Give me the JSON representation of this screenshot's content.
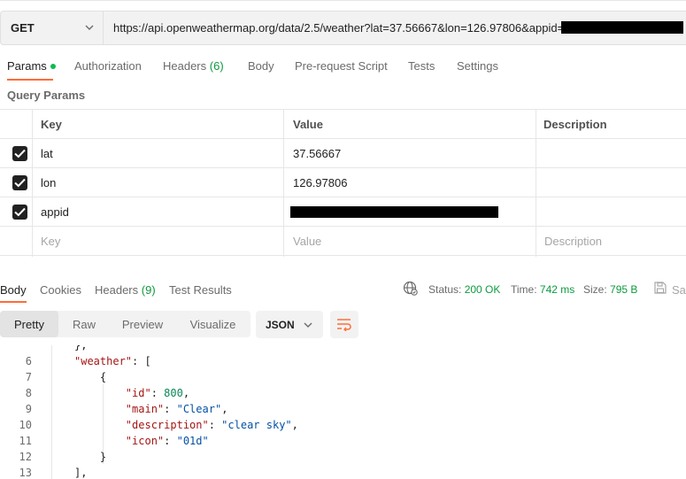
{
  "request": {
    "method": "GET",
    "url": "https://api.openweathermap.org/data/2.5/weather?lat=37.56667&lon=126.97806&appid="
  },
  "tabs": [
    {
      "label": "Params"
    },
    {
      "label": "Authorization"
    },
    {
      "label": "Headers",
      "count": "(6)"
    },
    {
      "label": "Body"
    },
    {
      "label": "Pre-request Script"
    },
    {
      "label": "Tests"
    },
    {
      "label": "Settings"
    }
  ],
  "query_params": {
    "title": "Query Params",
    "headers": {
      "key": "Key",
      "value": "Value",
      "description": "Description"
    },
    "rows": [
      {
        "key": "lat",
        "value": "37.56667"
      },
      {
        "key": "lon",
        "value": "126.97806"
      },
      {
        "key": "appid",
        "value": ""
      }
    ],
    "placeholder": {
      "key": "Key",
      "value": "Value",
      "description": "Description"
    }
  },
  "response": {
    "tabs": [
      {
        "label": "Body"
      },
      {
        "label": "Cookies"
      },
      {
        "label": "Headers",
        "count": "(9)"
      },
      {
        "label": "Test Results"
      }
    ],
    "status_label": "Status:",
    "status_value": "200 OK",
    "time_label": "Time:",
    "time_value": "742 ms",
    "size_label": "Size:",
    "size_value": "795 B",
    "save_label": "Sa"
  },
  "format": {
    "options": [
      "Pretty",
      "Raw",
      "Preview",
      "Visualize"
    ],
    "selected": "Pretty",
    "language": "JSON"
  },
  "code": {
    "line_numbers": [
      "6",
      "7",
      "8",
      "9",
      "10",
      "11",
      "12",
      "13"
    ],
    "weather_key": "\"weather\"",
    "id_key": "\"id\"",
    "id_value": "800",
    "main_key": "\"main\"",
    "main_value": "\"Clear\"",
    "description_key": "\"description\"",
    "description_value": "\"clear sky\"",
    "icon_key": "\"icon\"",
    "icon_value": "\"01d\""
  },
  "colors": {
    "accent": "#ff6c37",
    "success": "#0d9a3e"
  },
  "icons": [
    "chevron-down-icon",
    "checkbox-checked-icon",
    "globe-icon",
    "save-icon",
    "wrap-lines-icon"
  ]
}
